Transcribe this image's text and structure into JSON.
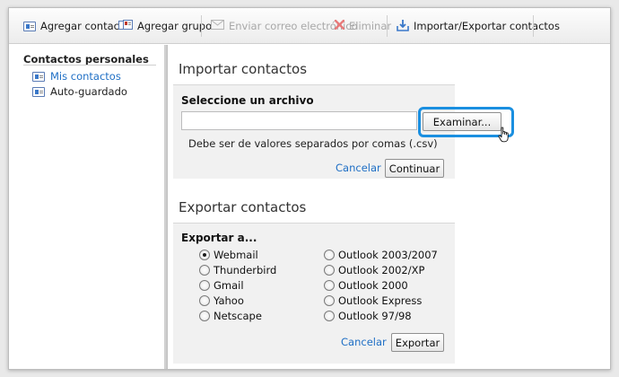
{
  "toolbar": {
    "add_contact": "Agregar contacto",
    "add_group": "Agregar grupo",
    "send_email": "Enviar correo electrónico",
    "delete": "Eliminar",
    "import_export": "Importar/Exportar contactos"
  },
  "sidebar": {
    "title": "Contactos personales",
    "items": [
      {
        "label": "Mis contactos",
        "active": true
      },
      {
        "label": "Auto-guardado",
        "active": false
      }
    ]
  },
  "import": {
    "title": "Importar contactos",
    "select_label": "Seleccione un archivo",
    "file_value": "",
    "browse_label": "Examinar...",
    "hint": "Debe ser de valores separados por comas (.csv)",
    "cancel_label": "Cancelar",
    "continue_label": "Continuar"
  },
  "export": {
    "title": "Exportar contactos",
    "to_label": "Exportar a...",
    "options_left": [
      "Webmail",
      "Thunderbird",
      "Gmail",
      "Yahoo",
      "Netscape"
    ],
    "options_right": [
      "Outlook 2003/2007",
      "Outlook 2002/XP",
      "Outlook 2000",
      "Outlook Express",
      "Outlook 97/98"
    ],
    "selected": "Webmail",
    "cancel_label": "Cancelar",
    "export_label": "Exportar"
  },
  "colors": {
    "link": "#1f6fc5",
    "highlight": "#1a8fe0"
  }
}
